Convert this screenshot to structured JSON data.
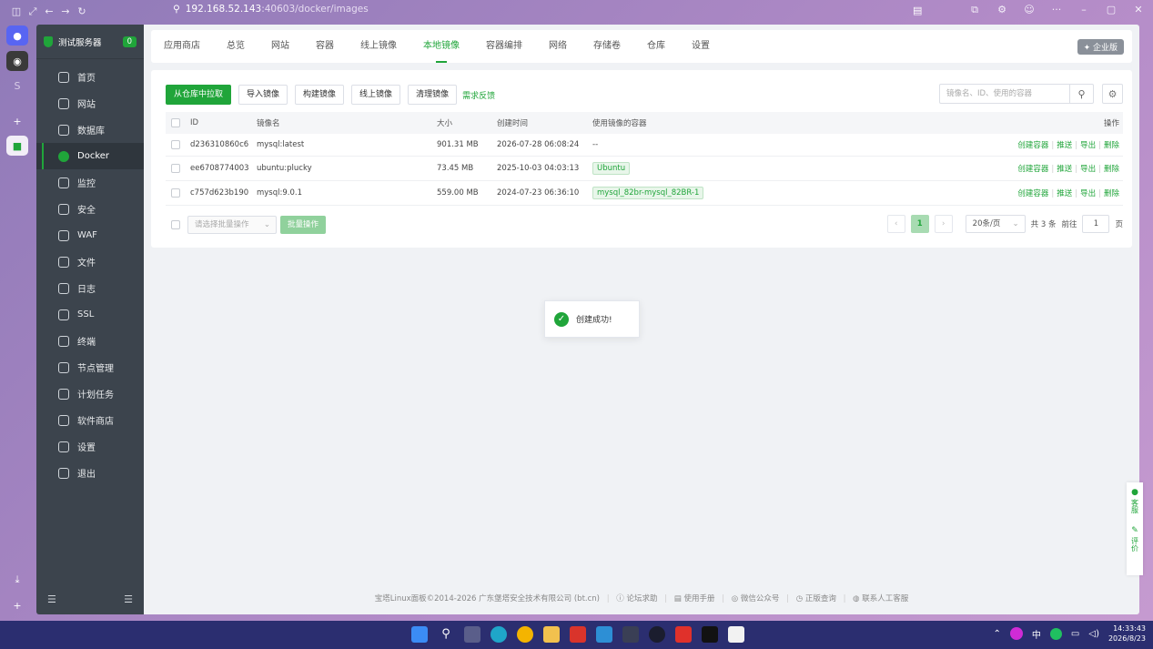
{
  "browser": {
    "url_host": "192.168.52.143",
    "url_path": ":40603/docker/images"
  },
  "sidebar": {
    "server_name": "测试服务器",
    "badge": "0",
    "items": [
      {
        "label": "首页",
        "icon": "home-icon"
      },
      {
        "label": "网站",
        "icon": "globe-icon"
      },
      {
        "label": "数据库",
        "icon": "database-icon"
      },
      {
        "label": "Docker",
        "icon": "docker-icon",
        "active": true
      },
      {
        "label": "监控",
        "icon": "monitor-icon"
      },
      {
        "label": "安全",
        "icon": "shield-icon"
      },
      {
        "label": "WAF",
        "icon": "waf-icon"
      },
      {
        "label": "文件",
        "icon": "folder-icon"
      },
      {
        "label": "日志",
        "icon": "log-icon"
      },
      {
        "label": "SSL",
        "icon": "ssl-icon"
      },
      {
        "label": "终端",
        "icon": "terminal-icon"
      },
      {
        "label": "节点管理",
        "icon": "node-icon"
      },
      {
        "label": "计划任务",
        "icon": "calendar-icon"
      },
      {
        "label": "软件商店",
        "icon": "store-icon"
      },
      {
        "label": "设置",
        "icon": "gear-icon"
      },
      {
        "label": "退出",
        "icon": "logout-icon"
      }
    ]
  },
  "topnav": {
    "tabs": [
      "应用商店",
      "总览",
      "网站",
      "容器",
      "线上镜像",
      "本地镜像",
      "容器编排",
      "网络",
      "存储卷",
      "仓库",
      "设置"
    ],
    "active_tab": "本地镜像",
    "enterprise": "企业版"
  },
  "toolbar": {
    "pull": "从仓库中拉取",
    "import": "导入镜像",
    "build": "构建镜像",
    "online": "线上镜像",
    "clean": "清理镜像",
    "feedback": "需求反馈",
    "search_placeholder": "镜像名、ID、使用的容器"
  },
  "table": {
    "headers": {
      "id": "ID",
      "name": "镜像名",
      "size": "大小",
      "time": "创建时间",
      "containers": "使用镜像的容器",
      "ops": "操作"
    },
    "rows": [
      {
        "id": "d236310860c6",
        "name": "mysql:latest",
        "size": "901.31 MB",
        "time": "2026-07-28 06:08:24",
        "container": "--",
        "tag": false
      },
      {
        "id": "ee6708774003",
        "name": "ubuntu:plucky",
        "size": "73.45 MB",
        "time": "2025-10-03 04:03:13",
        "container": "Ubuntu",
        "tag": true
      },
      {
        "id": "c757d623b190",
        "name": "mysql:9.0.1",
        "size": "559.00 MB",
        "time": "2024-07-23 06:36:10",
        "container": "mysql_82br-mysql_82BR-1",
        "tag": true
      }
    ],
    "ops": {
      "create": "创建容器",
      "push": "推送",
      "export": "导出",
      "delete": "删除"
    }
  },
  "batch": {
    "select_placeholder": "请选择批量操作",
    "button": "批量操作"
  },
  "pager": {
    "current": "1",
    "page_size": "20条/页",
    "total": "共 3 条",
    "goto": "前往",
    "page_input": "1",
    "page_unit": "页"
  },
  "toast": {
    "message": "创建成功!"
  },
  "float": {
    "service": "客服",
    "review": "评价"
  },
  "footer": {
    "copyright": "宝塔Linux面板©2014-2026 广东堡塔安全技术有限公司 (bt.cn)",
    "forum": "论坛求助",
    "manual": "使用手册",
    "wechat": "微信公众号",
    "verify": "正版查询",
    "contact": "联系人工客服"
  },
  "taskbar": {
    "ime": "中",
    "time": "14:33:43",
    "date": "2026/8/23"
  },
  "colors": {
    "accent": "#20a53a",
    "sidebar": "#3c444d"
  }
}
